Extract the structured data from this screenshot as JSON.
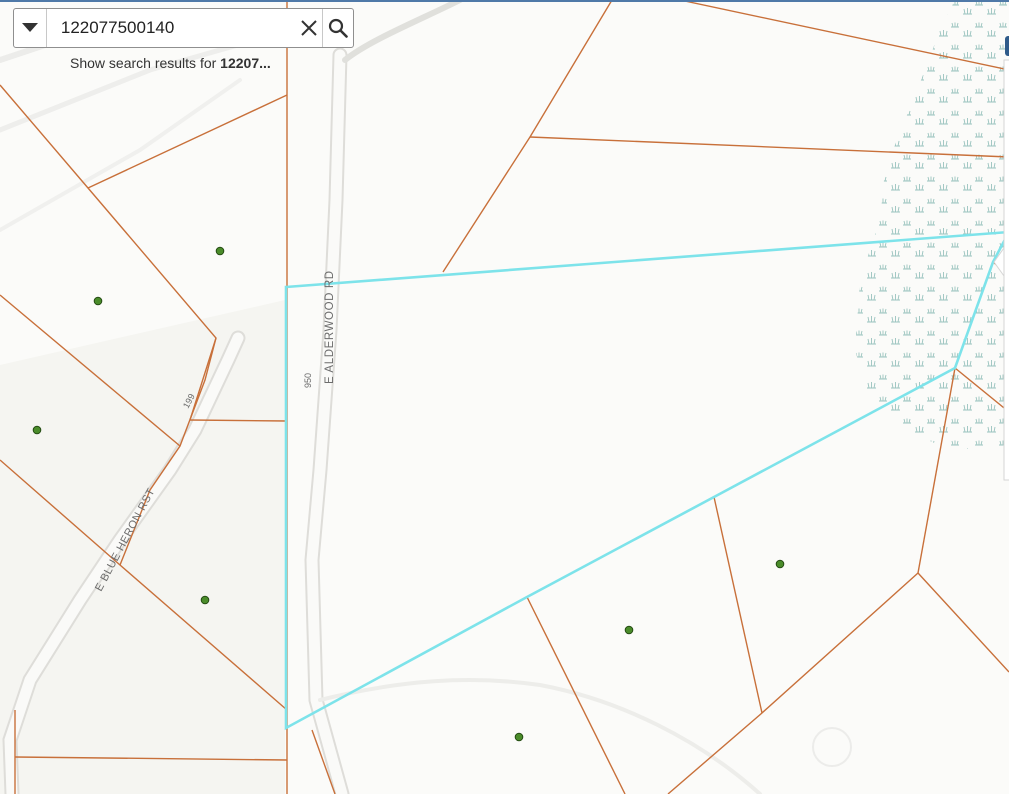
{
  "search": {
    "value": "122077500140",
    "suggestion_prefix": "Show search results for ",
    "suggestion_query": "12207..."
  },
  "map": {
    "road_labels": {
      "alderwood": "E ALDERWOOD RD",
      "alderwood_number": "950",
      "blue_heron": "E BLUE HERON RST",
      "blue_heron_number": "199"
    },
    "colors": {
      "parcel_line": "#c8703a",
      "selected_parcel": "#7de3ea",
      "address_point": "#4a8c2a",
      "road": "#e3e3e1",
      "wetland": "#8fbdb8"
    },
    "icons": {
      "dropdown": "chevron-down-icon",
      "clear": "close-icon",
      "search": "search-icon"
    }
  }
}
